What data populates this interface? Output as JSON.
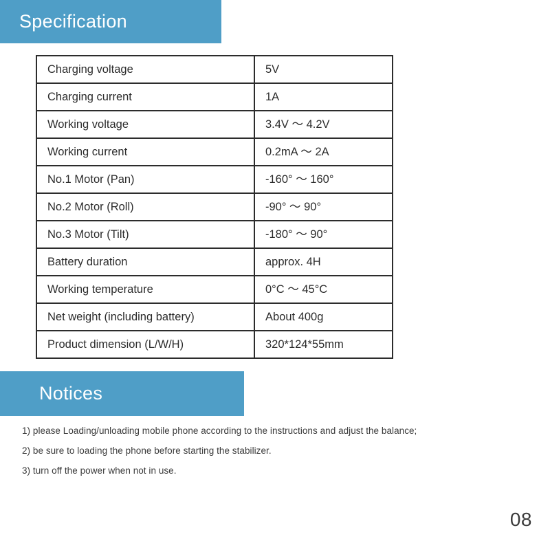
{
  "page": {
    "number": "08",
    "accent_color": "#4f9ec7",
    "background_color": "#ffffff",
    "text_color": "#2b2b2b"
  },
  "specification": {
    "heading": "Specification",
    "rows": [
      {
        "label": "Charging voltage",
        "value": "5V"
      },
      {
        "label": "Charging current",
        "value": "1A"
      },
      {
        "label": "Working voltage",
        "value": "3.4V ～ 4.2V"
      },
      {
        "label": "Working current",
        "value": "0.2mA ～ 2A"
      },
      {
        "label": "No.1 Motor (Pan)",
        "value": "-160° ～ 160°"
      },
      {
        "label": "No.2 Motor (Roll)",
        "value": "-90° ～ 90°"
      },
      {
        "label": "No.3 Motor (Tilt)",
        "value": "-180° ～ 90°"
      },
      {
        "label": "Battery duration",
        "value": "approx. 4H"
      },
      {
        "label": "Working temperature",
        "value": "0°C ～ 45°C"
      },
      {
        "label": "Net weight (including battery)",
        "value": "About 400g"
      },
      {
        "label": "Product dimension (L/W/H)",
        "value": "320*124*55mm"
      }
    ]
  },
  "notices": {
    "heading": "Notices",
    "items": [
      "1) please Loading/unloading mobile phone according to the instructions and adjust the balance;",
      "2) be sure to loading the phone before starting the stabilizer.",
      "3) turn off the power when not in use."
    ]
  }
}
